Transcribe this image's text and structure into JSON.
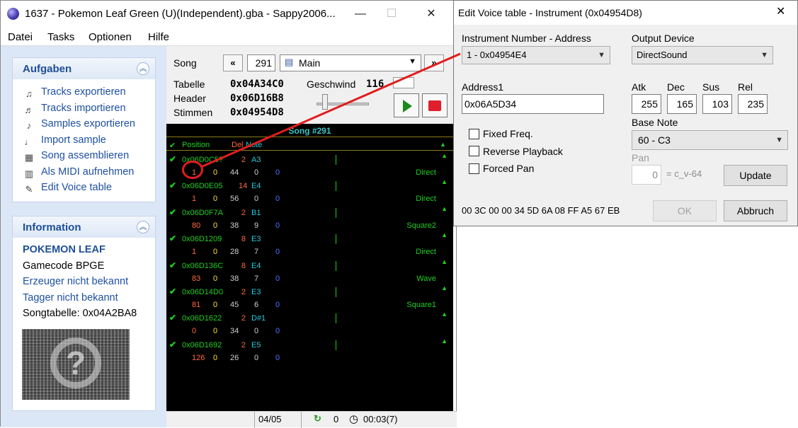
{
  "main_window": {
    "title": "1637 - Pokemon Leaf Green (U)(Independent).gba - Sappy2006...",
    "controls": {
      "minimize": "—",
      "maximize": "☐",
      "close": "✕"
    },
    "menu": [
      "Datei",
      "Tasks",
      "Optionen",
      "Hilfe"
    ]
  },
  "sidebar": {
    "tasks_title": "Aufgaben",
    "tasks": [
      {
        "label": "Tracks exportieren",
        "icon": "export-tracks-icon"
      },
      {
        "label": "Tracks importieren",
        "icon": "import-tracks-icon"
      },
      {
        "label": "Samples exportieren",
        "icon": "export-samples-icon"
      },
      {
        "label": "Import sample",
        "icon": "import-sample-icon"
      },
      {
        "label": "Song assemblieren",
        "icon": "assemble-icon"
      },
      {
        "label": "Als MIDI aufnehmen",
        "icon": "midi-icon"
      },
      {
        "label": "Edit Voice table",
        "icon": "edit-voice-icon"
      }
    ],
    "info_title": "Information",
    "info": {
      "game": "POKEMON LEAF",
      "gamecode": "Gamecode BPGE",
      "creator": "Erzeuger nicht bekannt",
      "tagger": "Tagger nicht bekannt",
      "songtable": "Songtabelle: 0x04A2BA8"
    }
  },
  "song": {
    "label": "Song",
    "prev": "«",
    "number": "291",
    "name": "Main",
    "next": "»",
    "table_label": "Tabelle",
    "table_value": "0x04A34C0",
    "speed_label": "Geschwind",
    "speed_value": "116",
    "header_label": "Header",
    "header_value": "0x06D16B8",
    "voices_label": "Stimmen",
    "voices_value": "0x04954D8"
  },
  "tracklist": {
    "title": "Song #291",
    "headers": {
      "position": "Position",
      "del": "Del",
      "note": "Note"
    },
    "rows": [
      {
        "addr": "0x06D0C5?",
        "del": "2",
        "note": "A3",
        "v1": "1",
        "v2": "0",
        "v3": "44",
        "v4": "0",
        "v5": "0",
        "inst": "Direct"
      },
      {
        "addr": "0x06D0E05",
        "del": "14",
        "note": "E4",
        "v1": "1",
        "v2": "0",
        "v3": "56",
        "v4": "0",
        "v5": "0",
        "inst": "Direct"
      },
      {
        "addr": "0x06D0F7A",
        "del": "2",
        "note": "B1",
        "v1": "80",
        "v2": "0",
        "v3": "38",
        "v4": "9",
        "v5": "0",
        "inst": "Square2"
      },
      {
        "addr": "0x06D1209",
        "del": "8",
        "note": "E3",
        "v1": "1",
        "v2": "0",
        "v3": "28",
        "v4": "7",
        "v5": "0",
        "inst": "Direct"
      },
      {
        "addr": "0x06D136C",
        "del": "8",
        "note": "E4",
        "v1": "83",
        "v2": "0",
        "v3": "38",
        "v4": "7",
        "v5": "0",
        "inst": "Wave"
      },
      {
        "addr": "0x06D14D0",
        "del": "2",
        "note": "E3",
        "v1": "81",
        "v2": "0",
        "v3": "45",
        "v4": "6",
        "v5": "0",
        "inst": "Square1"
      },
      {
        "addr": "0x06D1622",
        "del": "2",
        "note": "D#1",
        "v1": "0",
        "v2": "0",
        "v3": "34",
        "v4": "0",
        "v5": "0",
        "inst": ""
      },
      {
        "addr": "0x06D1692",
        "del": "2",
        "note": "E5",
        "v1": "126",
        "v2": "0",
        "v3": "26",
        "v4": "0",
        "v5": "0",
        "inst": ""
      }
    ]
  },
  "statusbar": {
    "tracks": "04/05",
    "loops": "0",
    "time": "00:03(7)"
  },
  "dialog": {
    "title": "Edit Voice table - Instrument (0x04954D8)",
    "close": "✕",
    "instrument_label": "Instrument Number - Address",
    "instrument_value": "1 - 0x04954E4",
    "output_label": "Output Device",
    "output_value": "DirectSound",
    "address_label": "Address1",
    "address_value": "0x06A5D34",
    "atk_label": "Atk",
    "atk": "255",
    "dec_label": "Dec",
    "dec": "165",
    "sus_label": "Sus",
    "sus": "103",
    "rel_label": "Rel",
    "rel": "235",
    "fixed_freq": "Fixed Freq.",
    "reverse": "Reverse Playback",
    "forced_pan": "Forced Pan",
    "base_note_label": "Base Note",
    "base_note_value": "60 - C3",
    "pan_label": "Pan",
    "pan_value": "0",
    "pan_text": "= c_v-64",
    "update": "Update",
    "hex": "00 3C 00 00 34 5D 6A 08 FF A5 67 EB",
    "ok": "OK",
    "cancel": "Abbruch"
  }
}
